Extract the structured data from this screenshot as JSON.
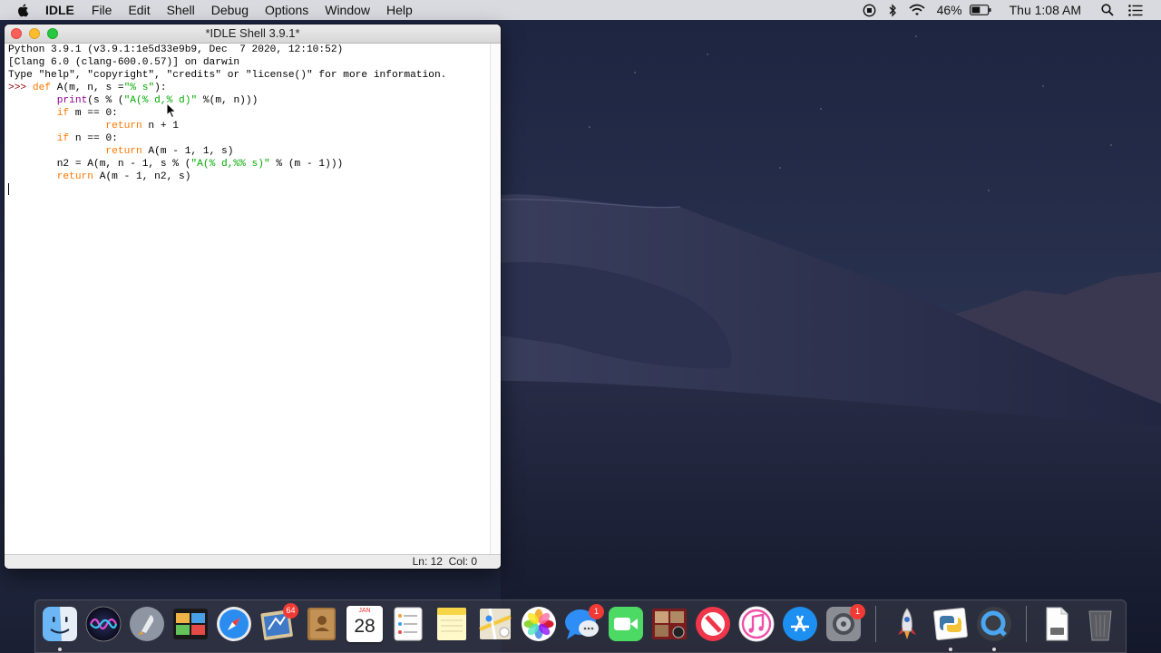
{
  "menubar": {
    "app_name": "IDLE",
    "menus": [
      "File",
      "Edit",
      "Shell",
      "Debug",
      "Options",
      "Window",
      "Help"
    ],
    "battery_percent": "46%",
    "clock": "Thu 1:08 AM"
  },
  "window": {
    "title": "*IDLE Shell 3.9.1*",
    "code_lines": [
      "Python 3.9.1 (v3.9.1:1e5d33e9b9, Dec  7 2020, 12:10:52)",
      "[Clang 6.0 (clang-600.0.57)] on darwin",
      "Type \"help\", \"copyright\", \"credits\" or \"license()\" for more information."
    ],
    "prompt": ">>> ",
    "status": "Ln: 12  Col: 0"
  },
  "dock": {
    "calendar_month": "JAN",
    "calendar_day": "28",
    "badges": {
      "mail": "64",
      "messages": "1",
      "system_preferences": "1"
    },
    "icons": [
      "finder-icon",
      "siri-icon",
      "launchpad-icon",
      "photo-booth-icon",
      "safari-icon",
      "mail-icon",
      "contacts-icon",
      "calendar-icon",
      "reminders-icon",
      "notes-icon",
      "maps-icon",
      "photos-icon",
      "messages-icon",
      "facetime-icon",
      "photo-booth-icon",
      "news-icon",
      "music-icon",
      "app-store-icon",
      "system-preferences-icon",
      "rocket-icon",
      "python-launcher-icon",
      "quicktime-icon",
      "document-icon",
      "trash-icon"
    ]
  }
}
